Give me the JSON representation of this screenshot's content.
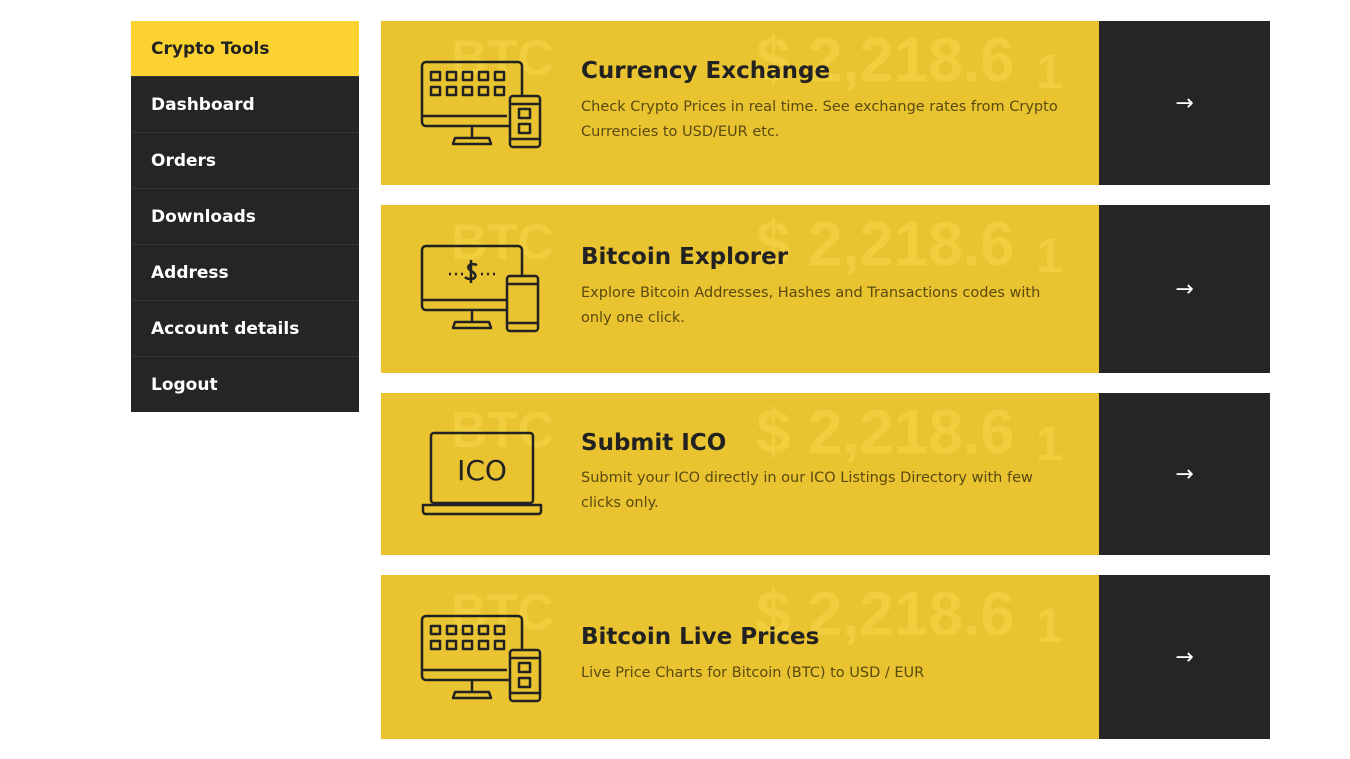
{
  "sidebar": {
    "items": [
      {
        "label": "Crypto Tools",
        "active": true
      },
      {
        "label": "Dashboard"
      },
      {
        "label": "Orders"
      },
      {
        "label": "Downloads"
      },
      {
        "label": "Address"
      },
      {
        "label": "Account details"
      },
      {
        "label": "Logout"
      }
    ]
  },
  "cards": [
    {
      "title": "Currency Exchange",
      "description": "Check Crypto Prices in real time. See exchange rates from Crypto Currencies to USD/EUR etc.",
      "icon": "monitor-phone-grid-icon",
      "arrow": "→"
    },
    {
      "title": "Bitcoin Explorer",
      "description": "Explore Bitcoin Addresses, Hashes and Transactions codes with only one click.",
      "icon": "monitor-phone-dollar-icon",
      "arrow": "→"
    },
    {
      "title": "Submit ICO",
      "description": "Submit your ICO directly in our ICO Listings Directory with few clicks only.",
      "icon": "laptop-ico-icon",
      "icon_text": "ICO",
      "arrow": "→"
    },
    {
      "title": "Bitcoin Live Prices",
      "description": "Live Price Charts for Bitcoin (BTC) to USD / EUR",
      "icon": "monitor-phone-grid-icon",
      "arrow": "→"
    }
  ],
  "colors": {
    "accent": "#fbd230",
    "card_yellow": "#e9c330",
    "dark": "#252525"
  }
}
